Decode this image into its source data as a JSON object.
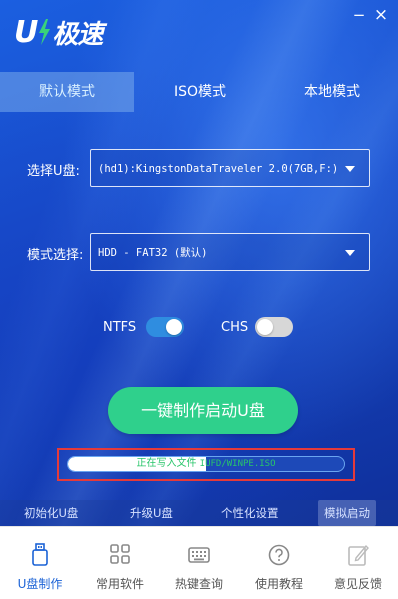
{
  "app": {
    "logo_letter": "U",
    "logo_text": "极速"
  },
  "window_controls": {
    "minimize_glyph": "−",
    "close_glyph": "×"
  },
  "tabs": [
    {
      "label": "默认模式",
      "active": true
    },
    {
      "label": "ISO模式",
      "active": false
    },
    {
      "label": "本地模式",
      "active": false
    }
  ],
  "form": {
    "drive_label": "选择U盘:",
    "drive_value": "(hd1):KingstonDataTraveler 2.0(7GB,F:)",
    "mode_label": "模式选择:",
    "mode_value": "HDD - FAT32 (默认)"
  },
  "toggles": {
    "ntfs": {
      "label": "NTFS",
      "on": true
    },
    "chs": {
      "label": "CHS",
      "on": false
    }
  },
  "start_button": {
    "label": "一键制作启动U盘"
  },
  "progress": {
    "status_prefix": "正在写入文件 ",
    "status_path": "IUFD/WINPE.ISO",
    "fraction": 0.5
  },
  "sub_links": [
    {
      "label": "初始化U盘"
    },
    {
      "label": "升级U盘"
    },
    {
      "label": "个性化设置"
    },
    {
      "label": "模拟启动"
    }
  ],
  "bottom_nav": [
    {
      "label": "U盘制作",
      "icon": "usb-drive-icon",
      "active": true
    },
    {
      "label": "常用软件",
      "icon": "apps-grid-icon",
      "active": false
    },
    {
      "label": "热键查询",
      "icon": "keyboard-icon",
      "active": false
    },
    {
      "label": "使用教程",
      "icon": "help-icon",
      "active": false
    },
    {
      "label": "意见反馈",
      "icon": "feedback-edit-icon",
      "active": false
    }
  ],
  "colors": {
    "accent_blue": "#1c63d6",
    "start_green": "#2fd08c",
    "toggle_on": "#2f8de0",
    "progress_text": "#28c56a",
    "highlight_red": "#e53a3a"
  }
}
